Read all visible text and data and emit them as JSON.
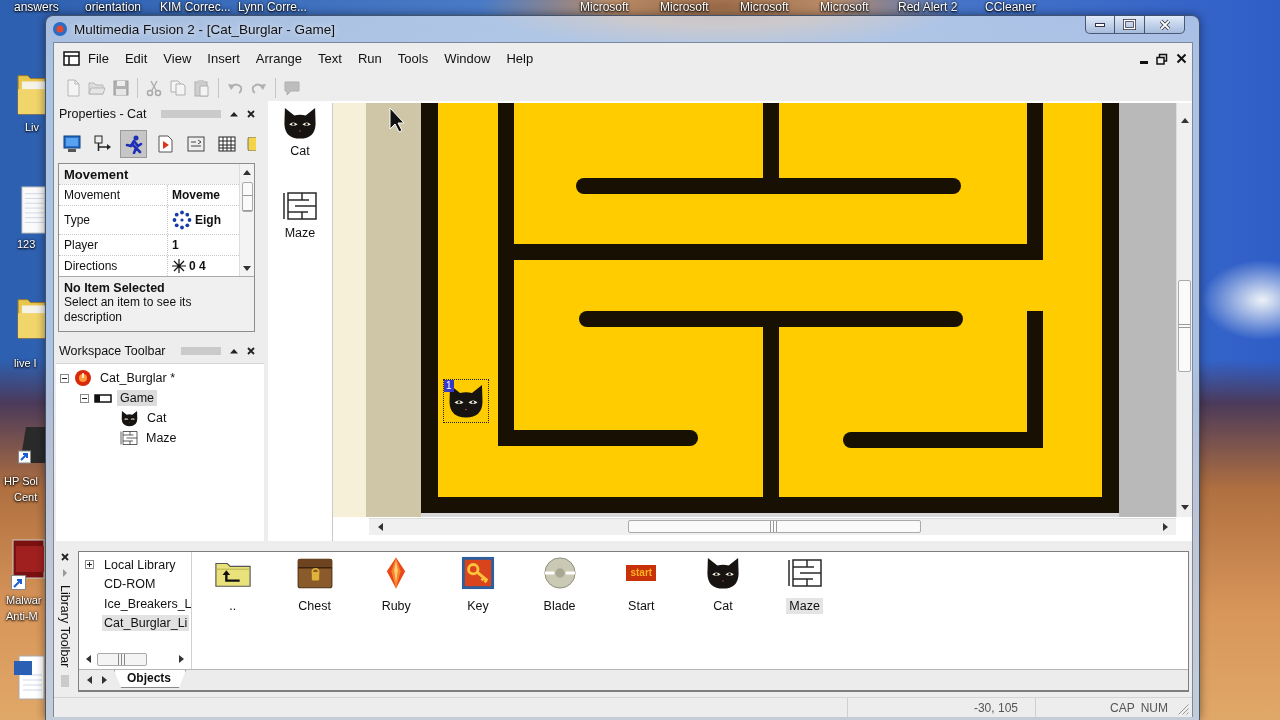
{
  "desktop": {
    "top_labels": [
      "answers",
      "orientation",
      "KIM Correc...",
      "Lynn Corre...",
      "Microsoft",
      "Microsoft",
      "Microsoft",
      "Microsoft",
      "Red Alert 2",
      "CCleaner"
    ],
    "side_icons": [
      {
        "kind": "folder",
        "lines": [
          "Liv"
        ]
      },
      {
        "kind": "document",
        "lines": [
          "123"
        ]
      },
      {
        "kind": "folder",
        "lines": [
          "live I"
        ]
      },
      {
        "kind": "hp",
        "lines": [
          "HP Sol",
          "Cent"
        ]
      },
      {
        "kind": "malware",
        "lines": [
          "Malwar",
          "Anti-M"
        ]
      },
      {
        "kind": "word"
      }
    ]
  },
  "window": {
    "title": "Multimedia Fusion 2 - [Cat_Burglar - Game]"
  },
  "menu": [
    "File",
    "Edit",
    "View",
    "Insert",
    "Arrange",
    "Text",
    "Run",
    "Tools",
    "Window",
    "Help"
  ],
  "toolbar": {
    "groups": [
      [
        {
          "kind": "new",
          "disabled": true
        },
        {
          "kind": "open",
          "disabled": true
        },
        {
          "kind": "save",
          "disabled": true
        }
      ],
      [
        {
          "kind": "cut",
          "disabled": true
        },
        {
          "kind": "copy",
          "disabled": true
        },
        {
          "kind": "paste",
          "disabled": true
        }
      ],
      [
        {
          "kind": "undo",
          "disabled": true
        },
        {
          "kind": "redo",
          "disabled": true
        }
      ],
      [
        {
          "kind": "comment",
          "disabled": true
        }
      ]
    ]
  },
  "properties": {
    "title": "Properties - Cat",
    "tabs": [
      {
        "selected": false
      },
      {
        "selected": false
      },
      {
        "selected": true
      },
      {
        "selected": false
      },
      {
        "selected": false
      },
      {
        "selected": false
      },
      {
        "selected": false
      }
    ],
    "section": "Movement",
    "rows": [
      {
        "name": "Movement",
        "value": "Moveme",
        "kind": "text"
      },
      {
        "name": "Type",
        "value": "Eigh",
        "kind": "dots"
      },
      {
        "name": "Player",
        "value": "1",
        "kind": "text"
      },
      {
        "name": "Directions",
        "value": "0 4",
        "kind": "star"
      }
    ],
    "help_title": "No Item Selected",
    "help_text": "Select an item to see its description"
  },
  "workspace": {
    "title": "Workspace Toolbar",
    "tree": [
      {
        "label": "Cat_Burglar *",
        "kind": "application",
        "expanded": true,
        "selected": false,
        "children": [
          {
            "label": "Game",
            "kind": "frame",
            "expanded": true,
            "selected": true,
            "children": [
              {
                "label": "Cat",
                "kind": "cat",
                "selected": false
              },
              {
                "label": "Maze",
                "kind": "maze",
                "selected": false
              }
            ]
          }
        ]
      }
    ]
  },
  "editor": {
    "objects": [
      {
        "label": "Cat",
        "kind": "cat"
      },
      {
        "label": "Maze",
        "kind": "maze"
      }
    ],
    "instances": [
      {
        "kind": "cat",
        "badge": "1",
        "selected": true
      }
    ]
  },
  "library": {
    "title": "Library Toolbar",
    "tree": [
      {
        "label": "Local Library",
        "expanded": false,
        "selected": false
      },
      {
        "label": "CD-ROM",
        "selected": false
      },
      {
        "label": "Ice_Breakers_L",
        "selected": false
      },
      {
        "label": "Cat_Burglar_Li",
        "selected": true
      }
    ],
    "tabs": [
      {
        "label": "Objects",
        "selected": true
      }
    ],
    "items": [
      {
        "label": "..",
        "kind": "parent-folder",
        "selected": false
      },
      {
        "label": "Chest",
        "kind": "chest",
        "selected": false
      },
      {
        "label": "Ruby",
        "kind": "ruby",
        "selected": false
      },
      {
        "label": "Key",
        "kind": "key",
        "selected": false
      },
      {
        "label": "Blade",
        "kind": "blade",
        "selected": false
      },
      {
        "label": "Start",
        "kind": "start",
        "icon_text": "start",
        "selected": false
      },
      {
        "label": "Cat",
        "kind": "cat",
        "selected": false
      },
      {
        "label": "Maze",
        "kind": "maze",
        "selected": true
      }
    ]
  },
  "status_bar": {
    "coordinates": "-30, 105",
    "caps": "CAP",
    "num": "NUM"
  }
}
